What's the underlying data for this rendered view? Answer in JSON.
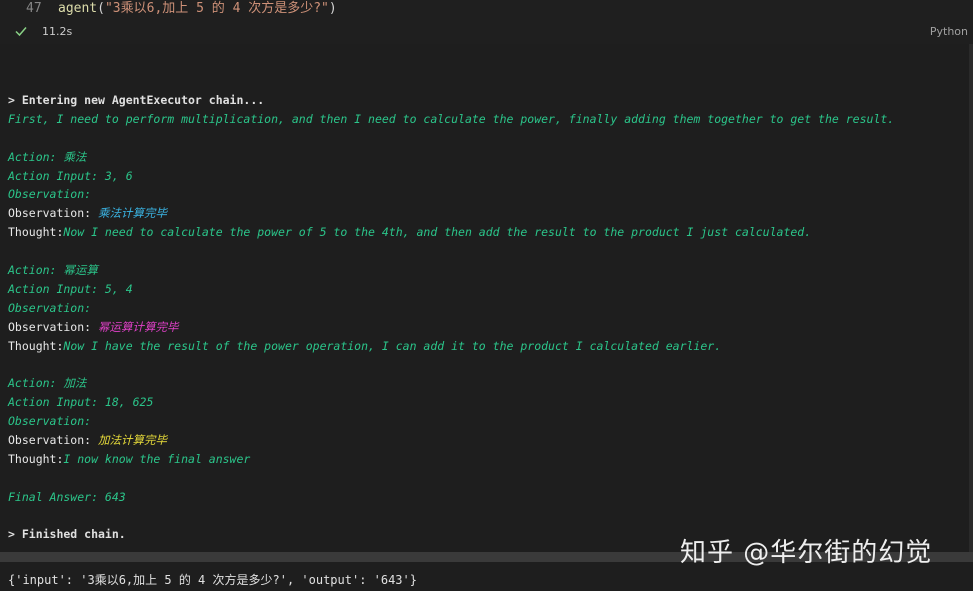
{
  "cell": {
    "line_number": "47",
    "code": {
      "fn": "agent",
      "open": "(",
      "string": "\"3乘以6,加上 5 的 4 次方是多少?\"",
      "close": ")"
    },
    "status": {
      "check_icon": "check-icon",
      "exec_time": "11.2s",
      "language": "Python"
    }
  },
  "output": {
    "lines": [
      {
        "style": "bold",
        "text": "> Entering new AgentExecutor chain..."
      },
      {
        "style": "green",
        "text": "First, I need to perform multiplication, and then I need to calculate the power, finally adding them together to get the result."
      },
      {
        "style": "blank",
        "text": ""
      },
      {
        "style": "green",
        "text": "Action: 乘法"
      },
      {
        "style": "green",
        "text": "Action Input: 3, 6"
      },
      {
        "style": "green",
        "text": "Observation:"
      },
      {
        "style": "obs",
        "label": "Observation: ",
        "value": "乘法计算完毕",
        "color": "cyan"
      },
      {
        "style": "thought",
        "label": "Thought:",
        "value": "Now I need to calculate the power of 5 to the 4th, and then add the result to the product I just calculated."
      },
      {
        "style": "blank",
        "text": ""
      },
      {
        "style": "green",
        "text": "Action: 幂运算"
      },
      {
        "style": "green",
        "text": "Action Input: 5, 4"
      },
      {
        "style": "green",
        "text": "Observation:"
      },
      {
        "style": "obs",
        "label": "Observation: ",
        "value": "幂运算计算完毕",
        "color": "magenta"
      },
      {
        "style": "thought",
        "label": "Thought:",
        "value": "Now I have the result of the power operation, I can add it to the product I calculated earlier."
      },
      {
        "style": "blank",
        "text": ""
      },
      {
        "style": "green",
        "text": "Action: 加法"
      },
      {
        "style": "green",
        "text": "Action Input: 18, 625"
      },
      {
        "style": "green",
        "text": "Observation:"
      },
      {
        "style": "obs",
        "label": "Observation: ",
        "value": "加法计算完毕",
        "color": "yellow"
      },
      {
        "style": "thought",
        "label": "Thought:",
        "value": "I now know the final answer"
      },
      {
        "style": "blank",
        "text": ""
      },
      {
        "style": "green",
        "text": "Final Answer: 643"
      },
      {
        "style": "blank",
        "text": ""
      },
      {
        "style": "bold",
        "text": "> Finished chain."
      }
    ],
    "result": "{'input': '3乘以6,加上 5 的 4 次方是多少?', 'output': '643'}"
  },
  "watermark": "知乎 @华尔街的幻觉",
  "colors": {
    "background": "#1f1f1f",
    "green": "#2bc58a",
    "cyan": "#3bb6e6",
    "magenta": "#e040c8",
    "yellow": "#e8dc3a"
  }
}
